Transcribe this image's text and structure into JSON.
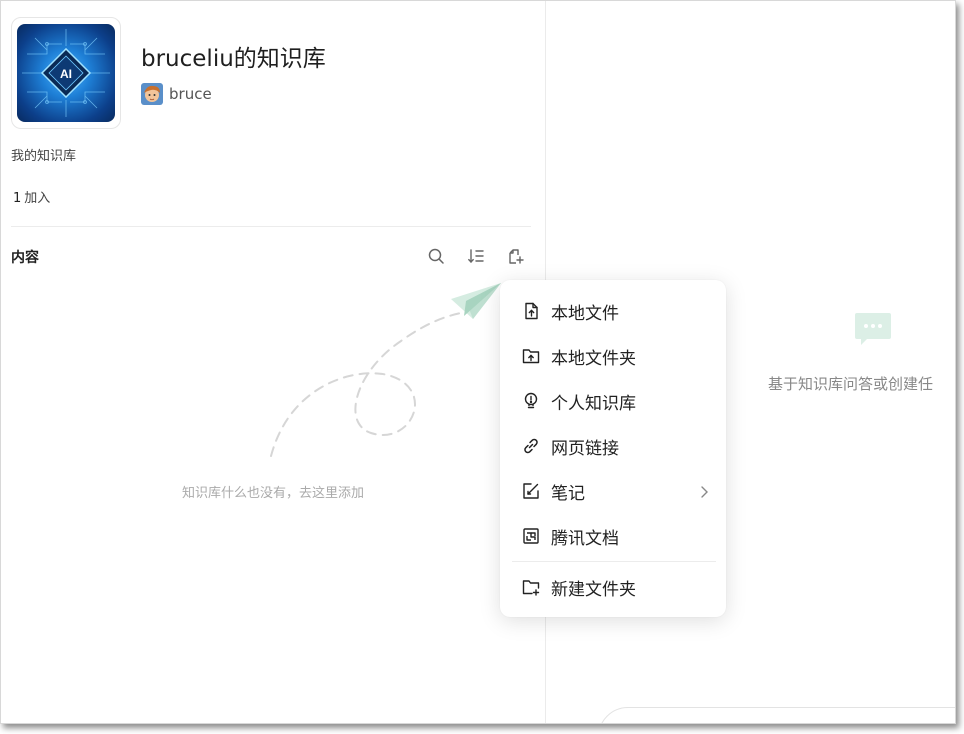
{
  "knowledge_base": {
    "title": "bruceliu的知识库",
    "owner_name": "bruce",
    "description": "我的知识库",
    "join_count": "1",
    "join_label": "加入",
    "cover_text": "AI"
  },
  "content_section": {
    "label": "内容",
    "empty_text": "知识库什么也没有，去这里添加",
    "toolbar": {
      "search_icon": "search-icon",
      "sort_icon": "sort-icon",
      "add_icon": "add-document-icon"
    }
  },
  "right_panel": {
    "hint": "基于知识库问答或创建任"
  },
  "add_menu": {
    "items": [
      {
        "label": "本地文件",
        "icon": "file-upload-icon"
      },
      {
        "label": "本地文件夹",
        "icon": "folder-upload-icon"
      },
      {
        "label": "个人知识库",
        "icon": "lightbulb-icon"
      },
      {
        "label": "网页链接",
        "icon": "link-icon"
      },
      {
        "label": "笔记",
        "icon": "note-edit-icon",
        "has_submenu": true
      },
      {
        "label": "腾讯文档",
        "icon": "tencent-doc-icon"
      },
      {
        "label": "新建文件夹",
        "icon": "new-folder-icon"
      }
    ]
  },
  "colors": {
    "accent_green": "#8fd3b6",
    "border": "#ececec",
    "muted_text": "#aaaaaa"
  }
}
